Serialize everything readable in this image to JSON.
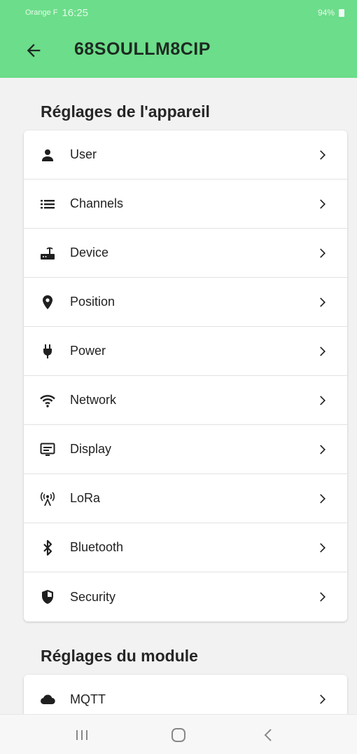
{
  "status_bar": {
    "carrier": "Orange F",
    "time": "16:25",
    "battery": "94%"
  },
  "toolbar": {
    "title": "68SOULLM8CIP",
    "back_icon": "arrow-left-icon"
  },
  "device_settings": {
    "title": "Réglages de l'appareil",
    "items": [
      {
        "label": "User",
        "icon": "person-icon"
      },
      {
        "label": "Channels",
        "icon": "list-icon"
      },
      {
        "label": "Device",
        "icon": "router-icon"
      },
      {
        "label": "Position",
        "icon": "location-pin-icon"
      },
      {
        "label": "Power",
        "icon": "power-plug-icon"
      },
      {
        "label": "Network",
        "icon": "wifi-icon"
      },
      {
        "label": "Display",
        "icon": "display-icon"
      },
      {
        "label": "LoRa",
        "icon": "antenna-icon"
      },
      {
        "label": "Bluetooth",
        "icon": "bluetooth-icon"
      },
      {
        "label": "Security",
        "icon": "shield-icon"
      }
    ]
  },
  "module_settings": {
    "title": "Réglages du module",
    "items": [
      {
        "label": "MQTT",
        "icon": "cloud-icon"
      }
    ]
  },
  "colors": {
    "app_bar": "#6cdd8a",
    "background": "#f2f2f2",
    "card": "#ffffff"
  },
  "nav_bar": {
    "icons": [
      "recents-icon",
      "home-icon",
      "back-icon"
    ]
  }
}
